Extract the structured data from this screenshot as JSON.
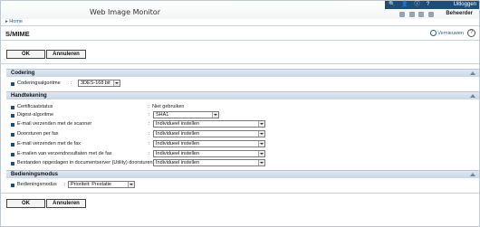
{
  "app": {
    "title": "Web Image Monitor",
    "logout_label": "Uitloggen",
    "manage_label": "Beheerder"
  },
  "breadcrumb": {
    "home_label": "Home"
  },
  "page": {
    "title": "S/MIME",
    "refresh_label": "Vernieuwen"
  },
  "buttons": {
    "ok_label": "OK",
    "cancel_label": "Annuleren"
  },
  "sections": {
    "encoding": {
      "title": "Codering",
      "rows": [
        {
          "label": "Coderingsalgoritme",
          "value": "3DES-168 bit"
        }
      ]
    },
    "signing": {
      "title": "Handtekening",
      "rows": [
        {
          "label": "Certificaatstatus",
          "value": "Niet gebruiken"
        },
        {
          "label": "Digest-algoritme",
          "value": "SHA1"
        },
        {
          "label": "E-mail verzenden met de scanner",
          "value": "Individueel instellen"
        },
        {
          "label": "Doorsturen per fax",
          "value": "Individueel instellen"
        },
        {
          "label": "E-mail verzenden met de fax",
          "value": "Individueel instellen"
        },
        {
          "label": "E-mailen van verzendresultaten met de fax",
          "value": "Individueel instellen"
        },
        {
          "label": "Bestanden opgeslagen in documentserver (Utility) doorsturen",
          "value": "Individueel instellen"
        }
      ]
    },
    "operation": {
      "title": "Bedieningsmodus",
      "rows": [
        {
          "label": "Bedieningsmodus",
          "value": "Prioriteit: Prestatie"
        }
      ]
    }
  },
  "colors": {
    "accent": "#1b4f7a",
    "link": "#1c5e9c",
    "section_bg": "#dfe8f2"
  }
}
